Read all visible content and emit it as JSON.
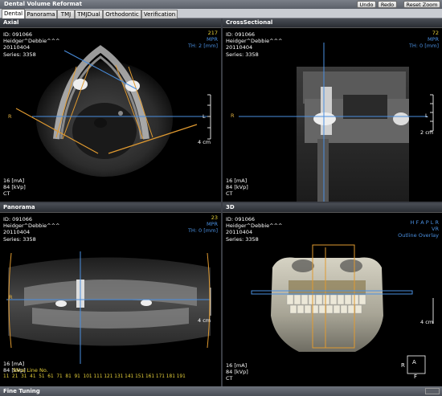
{
  "app": {
    "title": "Dental Volume Reformat"
  },
  "toolbar": {
    "undo": "Undo",
    "redo": "Redo",
    "reset_zoom": "Reset Zoom"
  },
  "tabs": [
    "Dental",
    "Panorama",
    "TMJ",
    "TMJDual",
    "Orthodontic",
    "Verification"
  ],
  "active_tab": "Dental",
  "patient": {
    "id": "ID: 091066",
    "name": "Heidger^Debbie^^^",
    "date": "20110404",
    "series": "Series: 3358"
  },
  "acquisition": {
    "ma": "16 [mA]",
    "kvp": "84 [kVp]",
    "modality": "CT"
  },
  "panels": {
    "axial": {
      "title": "Axial",
      "slice": "217",
      "mode": "MPR",
      "thickness": "TH: 2 [mm]",
      "left_marker": "R",
      "right_marker": "L",
      "scale": "4 cm"
    },
    "cross": {
      "title": "CrossSectional",
      "slice": "72",
      "mode": "MPR",
      "thickness": "TH: 0 [mm]",
      "left_marker": "R",
      "right_marker": "L",
      "scale": "2 cm"
    },
    "pano": {
      "title": "Panorama",
      "slice": "23",
      "mode": "MPR",
      "thickness": "TH: 0 [mm]",
      "marker": "R",
      "scale": "4 cm",
      "slice_line_label": "Slice Line No.",
      "ruler": "11  21  31  41  51  61  71  81  91  101 111 121 131 141 151 161 171 181 191"
    },
    "threed": {
      "title": "3D",
      "orientation": "H F A P L R",
      "mode": "VR",
      "overlay": "Outline Overlay",
      "scale": "4 cm",
      "cube_front": "A",
      "cube_left": "R",
      "cube_bottom": "F"
    }
  },
  "footer": {
    "label": "Fine Tuning"
  },
  "colors": {
    "overlay_blue": "#4a8fe0",
    "guide_orange": "#e09a30",
    "slice_yellow": "#e8d23a"
  }
}
